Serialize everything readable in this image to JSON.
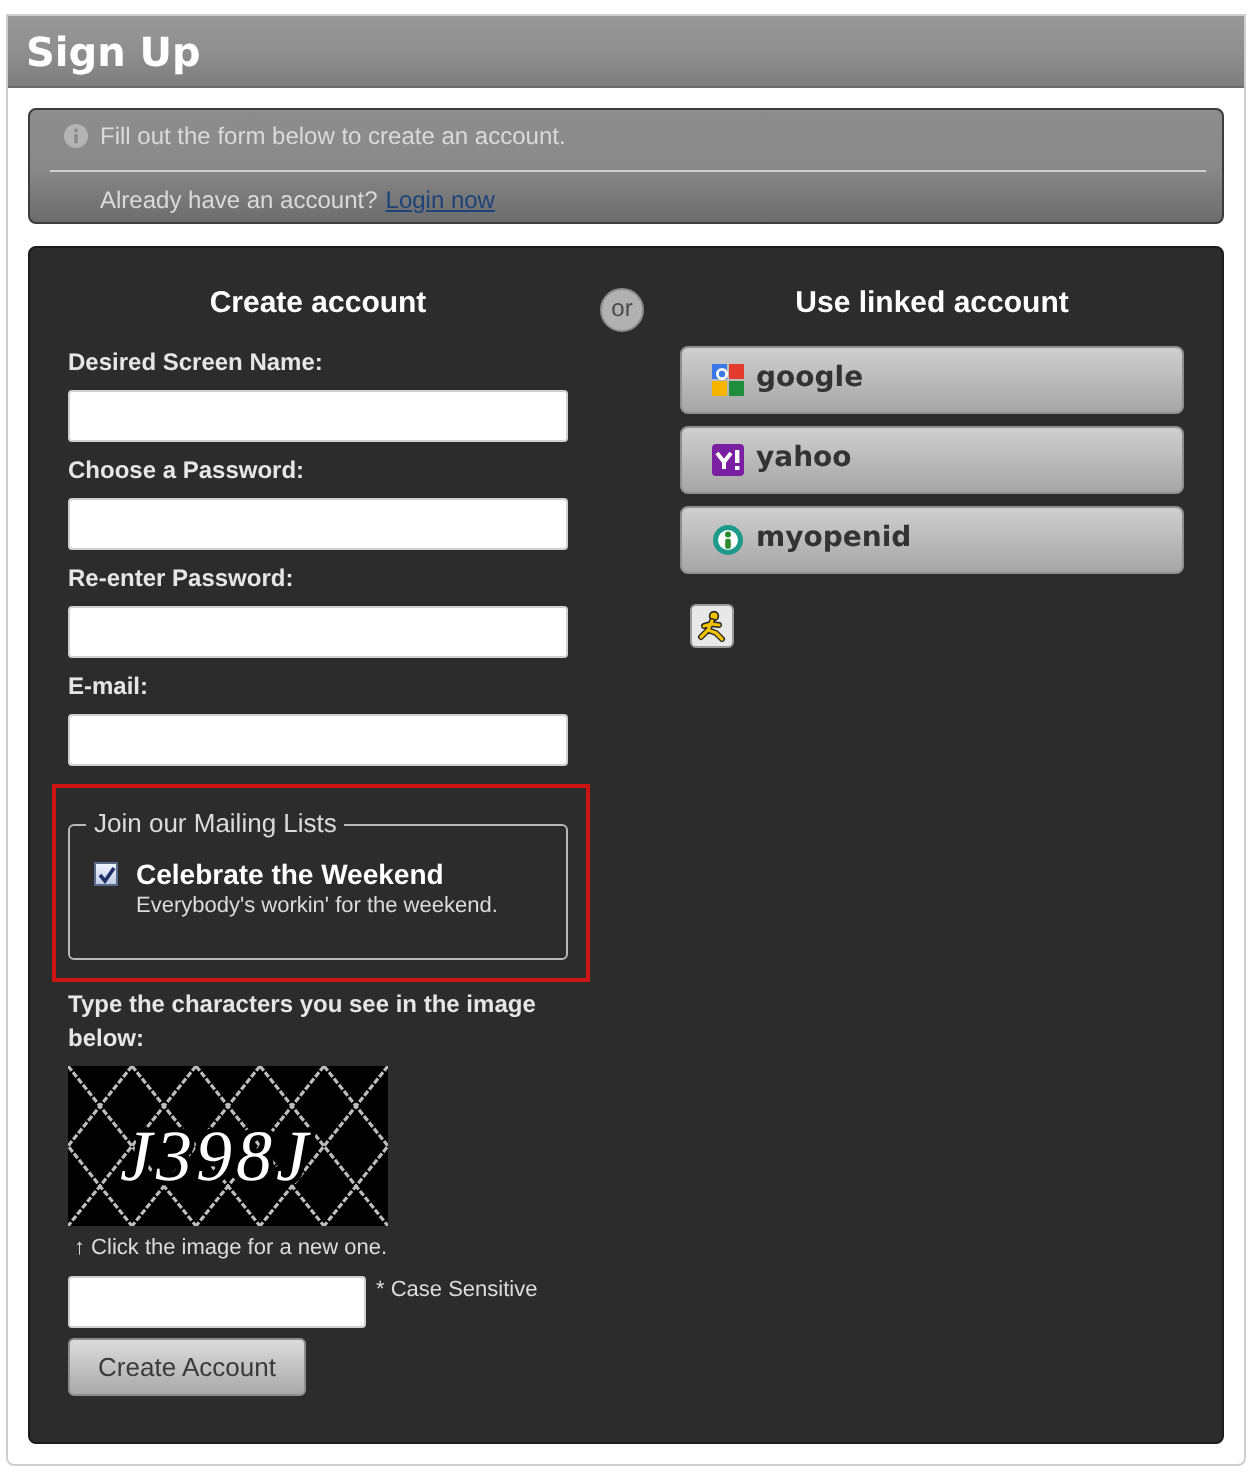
{
  "page": {
    "title": "Sign Up"
  },
  "notice": {
    "message": "Fill out the form below to create an account.",
    "login_prompt": "Already have an account?",
    "login_link": "Login now"
  },
  "create_account": {
    "heading": "Create account",
    "fields": [
      {
        "label": "Desired Screen Name:"
      },
      {
        "label": "Choose a Password:"
      },
      {
        "label": "Re-enter Password:"
      },
      {
        "label": "E-mail:"
      }
    ],
    "mailing_lists": {
      "highlighted": true,
      "legend": "Join our Mailing Lists",
      "items": [
        {
          "name": "Celebrate the Weekend",
          "description": "Everybody's workin' for the weekend.",
          "checked": true
        }
      ]
    },
    "captcha": {
      "prompt": "Type the characters you see in the image below:",
      "image_text": "J398J",
      "hint": "↑ Click the image for a new one.",
      "note": "* Case Sensitive"
    },
    "submit": "Create Account"
  },
  "separator": "or",
  "linked_accounts": {
    "heading": "Use linked account",
    "providers": [
      {
        "kind": "google",
        "label": "google"
      },
      {
        "kind": "yahoo",
        "label": "yahoo"
      },
      {
        "kind": "openid",
        "label": "myopenid"
      }
    ]
  }
}
